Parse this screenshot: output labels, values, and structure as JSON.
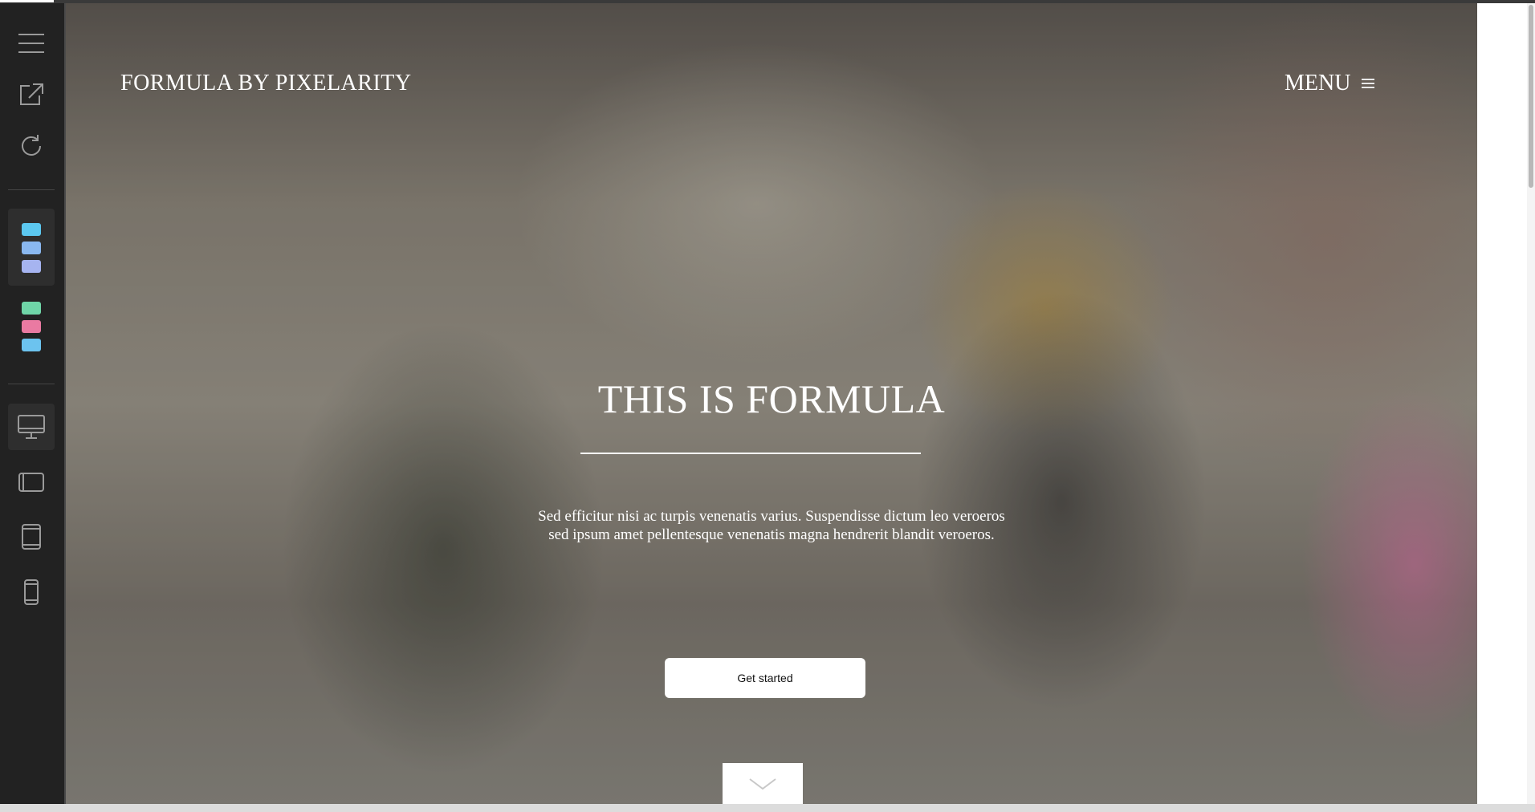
{
  "page": {
    "top_progress": 0.035
  },
  "sidebar": {
    "tools": [
      {
        "name": "hamburger-menu-icon"
      },
      {
        "name": "open-external-icon"
      },
      {
        "name": "reload-icon"
      }
    ],
    "color_schemes": [
      {
        "active": true,
        "colors": [
          "#5cc8f0",
          "#8ab8f0",
          "#a6b4f0"
        ]
      },
      {
        "active": false,
        "colors": [
          "#6fd6a8",
          "#ea7aa2",
          "#6cc3ef"
        ]
      }
    ],
    "devices": [
      {
        "name": "desktop-icon",
        "active": true
      },
      {
        "name": "tablet-landscape-icon",
        "active": false
      },
      {
        "name": "tablet-portrait-icon",
        "active": false
      },
      {
        "name": "phone-icon",
        "active": false
      }
    ]
  },
  "header": {
    "brand": "FORMULA BY PIXELARITY",
    "menu_label": "MENU"
  },
  "hero": {
    "title": "THIS IS FORMULA",
    "lede": "Sed efficitur nisi ac turpis venenatis varius. Suspendisse dictum leo veroeros sed ipsum amet pellentesque venenatis magna hendrerit blandit veroeros.",
    "cta_label": "Get started"
  }
}
